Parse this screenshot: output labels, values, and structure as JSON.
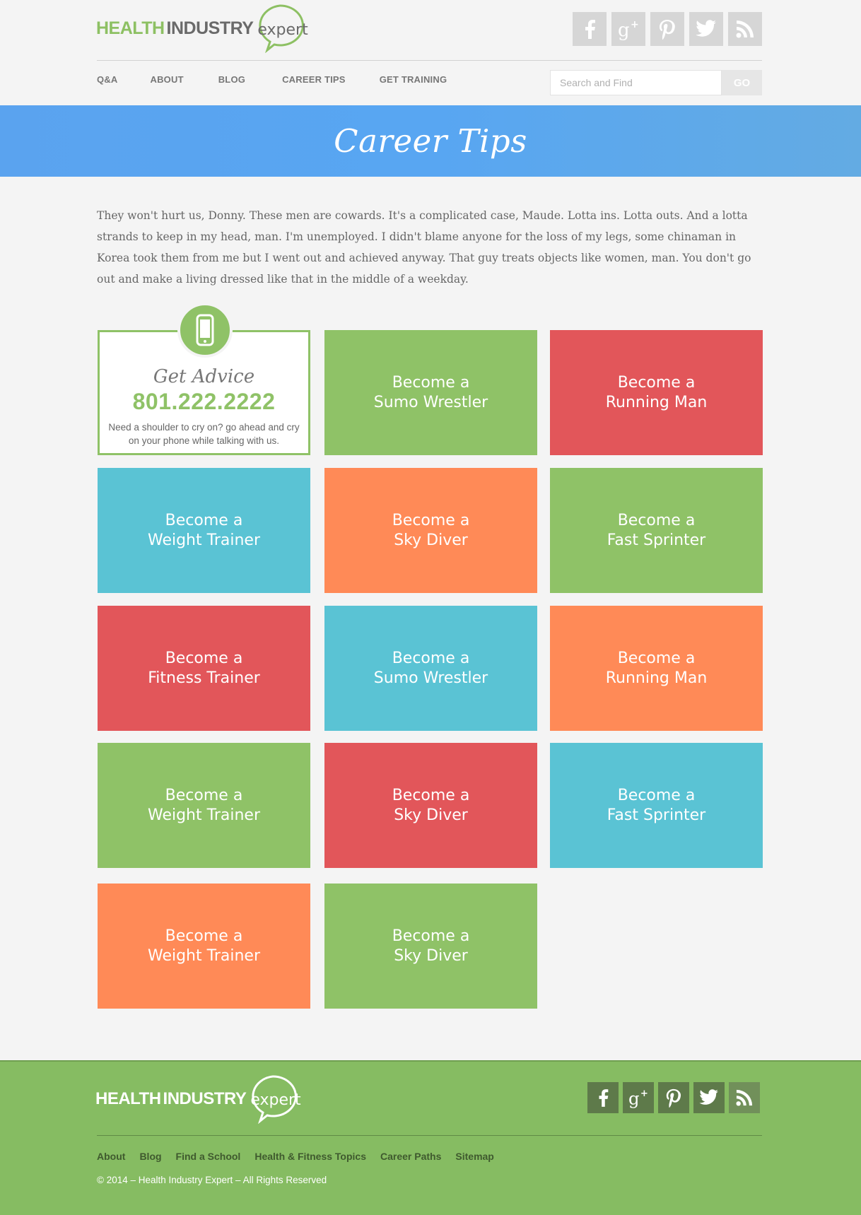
{
  "header": {
    "logo": {
      "word1": "HEALTH",
      "word2": "INDUSTRY",
      "word3": "expert"
    },
    "social": [
      "facebook-icon",
      "google-plus-icon",
      "pinterest-icon",
      "twitter-icon",
      "rss-icon"
    ],
    "nav": [
      "Q&A",
      "ABOUT",
      "BLOG",
      "CAREER TIPS",
      "GET TRAINING"
    ],
    "search": {
      "placeholder": "Search and Find",
      "button": "GO"
    }
  },
  "banner": {
    "title": "Career Tips"
  },
  "intro": "They won't hurt us, Donny. These men are cowards. It's a complicated case, Maude. Lotta ins. Lotta outs. And a lotta strands to keep in my head, man. I'm unemployed. I didn't blame anyone for the loss of my legs, some chinaman in Korea took them from me but I went out and achieved anyway. That guy treats objects like women, man. You don't go out and make a living dressed like that in the middle of a weekday.",
  "advice": {
    "title": "Get Advice",
    "phone": "801.222.2222",
    "text": "Need a shoulder to cry on? go ahead and cry on your phone while talking with us."
  },
  "tiles": [
    {
      "l1": "Become a",
      "l2": "Sumo Wrestler",
      "color": "green"
    },
    {
      "l1": "Become a",
      "l2": "Running Man",
      "color": "red"
    },
    {
      "l1": "Become a",
      "l2": "Weight Trainer",
      "color": "blue"
    },
    {
      "l1": "Become a",
      "l2": "Sky Diver",
      "color": "orange"
    },
    {
      "l1": "Become a",
      "l2": "Fast Sprinter",
      "color": "green"
    },
    {
      "l1": "Become a",
      "l2": "Fitness Trainer",
      "color": "red"
    },
    {
      "l1": "Become a",
      "l2": "Sumo Wrestler",
      "color": "blue"
    },
    {
      "l1": "Become a",
      "l2": "Running Man",
      "color": "orange"
    },
    {
      "l1": "Become a",
      "l2": "Weight Trainer",
      "color": "green"
    },
    {
      "l1": "Become a",
      "l2": "Sky Diver",
      "color": "red"
    },
    {
      "l1": "Become a",
      "l2": "Fast Sprinter",
      "color": "blue"
    },
    {
      "l1": "Become a",
      "l2": "Weight Trainer",
      "color": "orange"
    },
    {
      "l1": "Become a",
      "l2": "Sky Diver",
      "color": "green"
    }
  ],
  "colors": {
    "green": "#8fc267",
    "red": "#e2565a",
    "blue": "#5ac3d4",
    "orange": "#ff8a57",
    "banner": "#58a6f2"
  },
  "footer": {
    "logo": {
      "word1": "HEALTH",
      "word2": "INDUSTRY",
      "word3": "expert"
    },
    "links": [
      "About",
      "Blog",
      "Find a School",
      "Health & Fitness Topics",
      "Career Paths",
      "Sitemap"
    ],
    "copyright": "© 2014 – Health Industry Expert – All Rights Reserved"
  }
}
